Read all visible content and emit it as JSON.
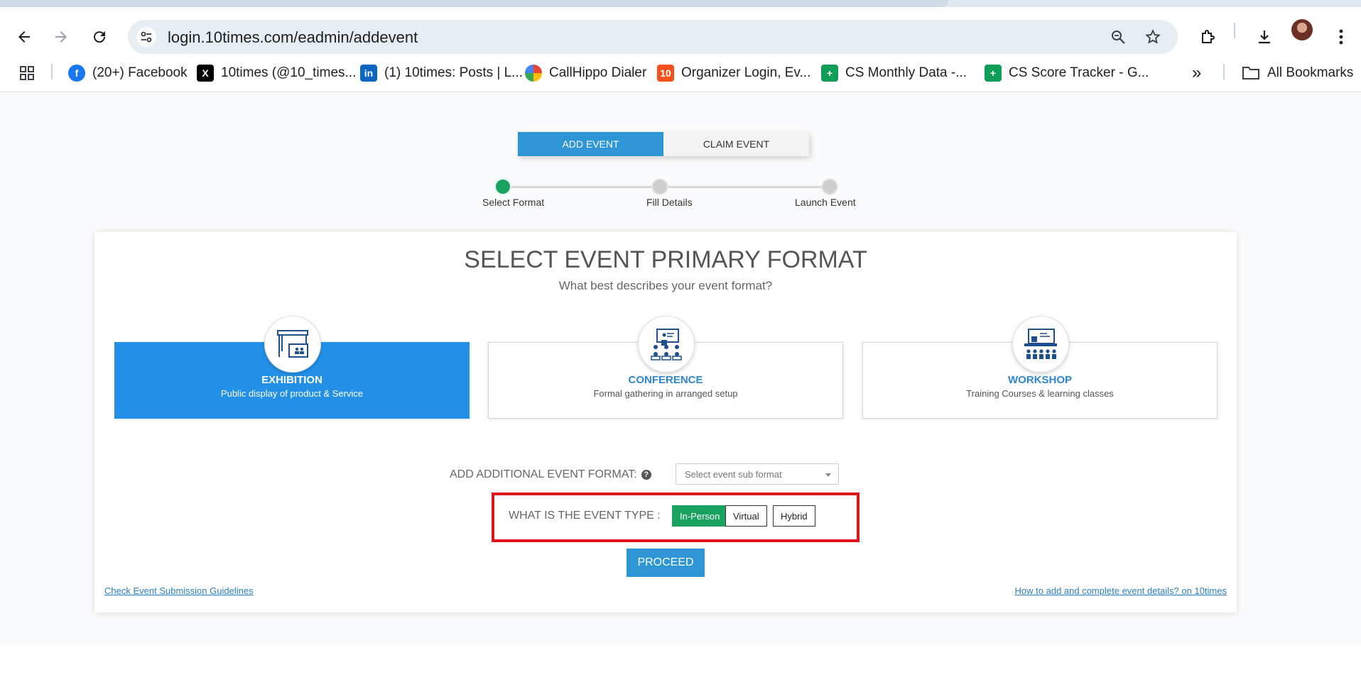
{
  "browser": {
    "url": "login.10times.com/eadmin/addevent",
    "icons": [
      "back-icon",
      "forward-icon",
      "reload-icon",
      "site-settings-icon",
      "zoom-icon",
      "bookmark-star-icon",
      "extensions-icon",
      "download-icon",
      "profile-avatar",
      "menu-icon"
    ]
  },
  "bookmarks": {
    "items": [
      {
        "label": "(20+) Facebook",
        "color": "#1877f2"
      },
      {
        "label": "10times (@10_times...",
        "color": "#000000"
      },
      {
        "label": "(1) 10times: Posts | L...",
        "color": "#0a66c2"
      },
      {
        "label": "CallHippo Dialer",
        "color": "#ea4335"
      },
      {
        "label": "Organizer Login, Ev...",
        "color": "#f4511e"
      },
      {
        "label": "CS Monthly Data -...",
        "color": "#0f9d58"
      },
      {
        "label": "CS Score Tracker - G...",
        "color": "#0f9d58"
      }
    ],
    "all_bookmarks": "All Bookmarks",
    "overflow": "»"
  },
  "tabs": {
    "add_event": "ADD EVENT",
    "claim_event": "CLAIM EVENT"
  },
  "stepper": {
    "steps": [
      "Select Format",
      "Fill Details",
      "Launch Event"
    ],
    "current_step": 1
  },
  "main": {
    "title": "SELECT EVENT PRIMARY FORMAT",
    "subtitle": "What best describes your event format?",
    "formats": [
      {
        "name": "EXHIBITION",
        "desc": "Public display of product & Service",
        "selected": true
      },
      {
        "name": "CONFERENCE",
        "desc": "Formal gathering in arranged setup",
        "selected": false
      },
      {
        "name": "WORKSHOP",
        "desc": "Training Courses & learning classes",
        "selected": false
      }
    ],
    "additional_label": "ADD ADDITIONAL EVENT FORMAT:",
    "sub_format_placeholder": "Select event sub format",
    "event_type_label": "WHAT IS THE EVENT TYPE :",
    "event_types": [
      "In-Person",
      "Virtual",
      "Hybrid"
    ],
    "event_type_selected": "In-Person",
    "proceed": "PROCEED",
    "guidelines_link": "Check Event Submission Guidelines",
    "howto_link": "How to add and complete event details? on 10times"
  },
  "colors": {
    "accent_blue": "#2f96d6",
    "selected_card": "#2390e8",
    "green": "#1aa260",
    "highlight_red": "#e0151c"
  }
}
